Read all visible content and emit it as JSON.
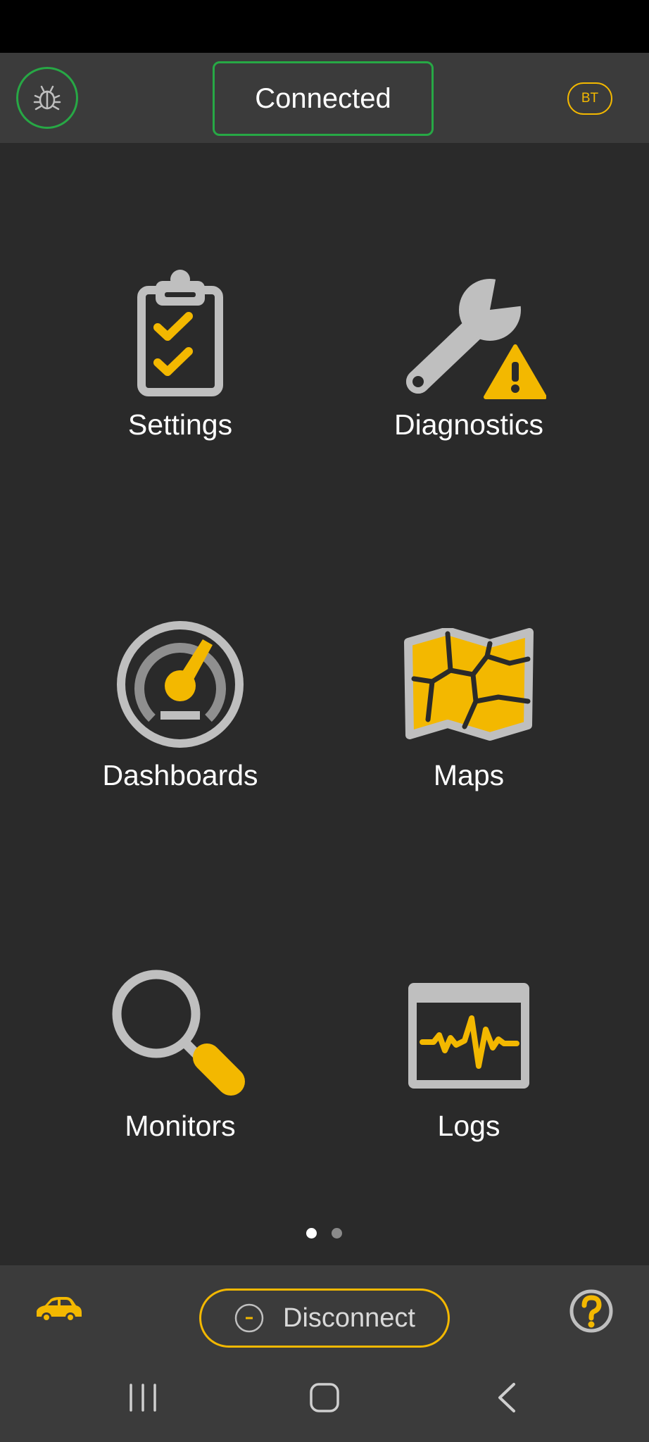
{
  "header": {
    "status": "Connected",
    "badge": "BT"
  },
  "tiles": [
    {
      "label": "Settings",
      "icon": "clipboard-check-icon"
    },
    {
      "label": "Diagnostics",
      "icon": "wrench-warning-icon"
    },
    {
      "label": "Dashboards",
      "icon": "gauge-icon"
    },
    {
      "label": "Maps",
      "icon": "map-icon"
    },
    {
      "label": "Monitors",
      "icon": "magnifier-icon"
    },
    {
      "label": "Logs",
      "icon": "waveform-monitor-icon"
    }
  ],
  "pager": {
    "active": 1,
    "total": 2
  },
  "footer": {
    "disconnect_label": "Disconnect"
  },
  "colors": {
    "accent": "#f3b800",
    "connected": "#27a845",
    "icon_gray": "#bfbfbf",
    "background": "#2a2a2a",
    "bar": "#3b3b3b"
  }
}
